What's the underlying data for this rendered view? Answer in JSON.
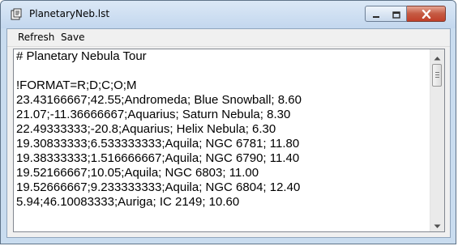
{
  "window": {
    "title": "PlanetaryNeb.lst"
  },
  "menu": {
    "items": [
      "Refresh",
      "Save"
    ]
  },
  "editor": {
    "lines": [
      "# Planetary Nebula Tour",
      "",
      "!FORMAT=R;D;C;O;M",
      "23.43166667;42.55;Andromeda; Blue Snowball; 8.60",
      "21.07;-11.36666667;Aquarius; Saturn Nebula; 8.30",
      "22.49333333;-20.8;Aquarius; Helix Nebula; 6.30",
      "19.30833333;6.533333333;Aquila; NGC 6781; 11.80",
      "19.38333333;1.516666667;Aquila; NGC 6790; 11.40",
      "19.52166667;10.05;Aquila; NGC 6803; 11.00",
      "19.52666667;9.233333333;Aquila; NGC 6804; 12.40",
      "5.94;46.10083333;Auriga; IC 2149; 10.60"
    ]
  },
  "icons": {
    "app": "notepad-document-icon",
    "minimize": "minimize-icon",
    "maximize": "maximize-icon",
    "close": "close-icon"
  },
  "colors": {
    "frame": "#c9dcef",
    "close_button": "#c55a42"
  }
}
